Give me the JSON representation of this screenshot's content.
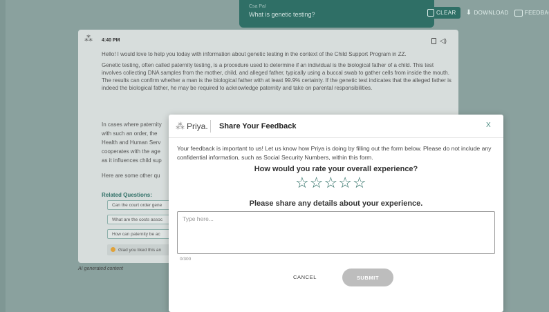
{
  "header": {
    "user_name": "Csa Pal",
    "user_message": "What is genetic testing?",
    "toolbar": [
      {
        "label": "CLEAR",
        "icon": "clear-icon"
      },
      {
        "label": "DOWNLOAD",
        "icon": "download-icon"
      },
      {
        "label": "FEEDBAC",
        "icon": "feedback-icon"
      }
    ]
  },
  "message": {
    "time": "4:40 PM",
    "icons": [
      "copy-icon",
      "speaker-icon"
    ],
    "para1": "Hello! I would love to help you today with information about genetic testing in the context of the Child Support Program in ZZ.",
    "para2": "Genetic testing, often called paternity testing, is a procedure used to determine if an individual is the biological father of a child. This test involves collecting DNA samples from the mother, child, and alleged father, typically using a buccal swab to gather cells from inside the mouth. The results can confirm whether a man is the biological father with at least 99.9% certainty. If the genetic test indicates that the alleged father is indeed the biological father, he may be required to acknowledge paternity and take on parental responsibilities.",
    "para3a": "In cases where paternity",
    "para3b": "with such an order, the",
    "para3c": "Health and Human Serv",
    "para3d": "cooperates with the age",
    "para3e": "as it influences child sup",
    "para4": "Here are some other qu",
    "related_label": "Related Questions:",
    "related": [
      "Can the court order gene",
      "What are the costs assoc",
      "How can paternity be ac"
    ],
    "glad": "Glad you liked this an",
    "ai_note": "AI generated content"
  },
  "modal": {
    "logo_text": "Priya.",
    "title": "Share Your Feedback",
    "close": "X",
    "intro": "Your feedback is important to us! Let us know how Priya is doing by filling out the form below. Please do not include any confidential information, such as Social Security Numbers, within this form.",
    "rating_question": "How would you rate your overall experience?",
    "rating_stars_max": 5,
    "rating_value": 0,
    "details_question": "Please share any details about your experience.",
    "textarea_placeholder": "Type here...",
    "textarea_value": "",
    "counter": "0/300",
    "cancel_label": "CANCEL",
    "submit_label": "SUBMIT"
  },
  "colors": {
    "accent": "#2f6f66",
    "overlay": "#7f9794",
    "submit_disabled": "#bdbdbd"
  }
}
